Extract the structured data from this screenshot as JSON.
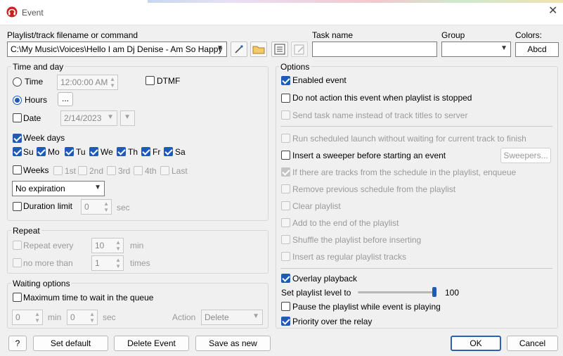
{
  "window": {
    "title": "Event",
    "app_icon": "headphones-app-icon",
    "close_icon": "close-icon"
  },
  "command": {
    "label": "Playlist/track filename or command",
    "value": "C:\\My Music\\Voices\\Hello I am Dj Denise - Am So Happy",
    "tools": [
      "wand-icon",
      "folder-icon",
      "list-icon",
      "edit-icon"
    ]
  },
  "task": {
    "label": "Task name",
    "value": ""
  },
  "group": {
    "label": "Group",
    "value": ""
  },
  "colors": {
    "label": "Colors:",
    "sample": "Abcd"
  },
  "time_and_day": {
    "title": "Time and day",
    "time_label": "Time",
    "time_value": "12:00:00 AM",
    "dtmf_label": "DTMF",
    "hours_label": "Hours",
    "hours_button": "...",
    "date_label": "Date",
    "date_value": "2/14/2023",
    "week_days_label": "Week days",
    "days": [
      "Su",
      "Mo",
      "Tu",
      "We",
      "Th",
      "Fr",
      "Sa"
    ],
    "weeks_label": "Weeks",
    "weeks": [
      "1st",
      "2nd",
      "3rd",
      "4th",
      "Last"
    ],
    "expiration_value": "No expiration",
    "duration_label": "Duration limit",
    "duration_value": "0",
    "duration_unit": "sec"
  },
  "repeat": {
    "title": "Repeat",
    "every_label": "Repeat every",
    "every_value": "10",
    "every_unit": "min",
    "nomore_label": "no more than",
    "nomore_value": "1",
    "nomore_unit": "times"
  },
  "waiting": {
    "title": "Waiting options",
    "max_label": "Maximum time to wait in the queue",
    "min_value": "0",
    "min_unit": "min",
    "sec_value": "0",
    "sec_unit": "sec",
    "action_label": "Action",
    "action_value": "Delete"
  },
  "options": {
    "title": "Options",
    "enabled": "Enabled event",
    "no_action": "Do not action this event when playlist is stopped",
    "send_task": "Send task name instead of track titles to server",
    "run_sched": "Run scheduled launch without waiting for current track to finish",
    "sweeper": "Insert a sweeper before starting an event",
    "sweepers_button": "Sweepers...",
    "enqueue": "If there are tracks from the schedule in the playlist, enqueue",
    "remove_prev": "Remove previous schedule from the playlist",
    "clear": "Clear playlist",
    "add_end": "Add to the end of the playlist",
    "shuffle": "Shuffle the playlist before inserting",
    "insert_regular": "Insert as regular playlist tracks",
    "overlay": "Overlay playback",
    "level_label": "Set playlist level to",
    "level_value": "100",
    "level_fraction": 1.0,
    "pause": "Pause the playlist while event is playing",
    "priority": "Priority over the relay"
  },
  "footer": {
    "help": "?",
    "set_default": "Set default",
    "delete_event": "Delete Event",
    "save_new": "Save as new",
    "ok": "OK",
    "cancel": "Cancel"
  },
  "accent_color": "#1f5bb5"
}
